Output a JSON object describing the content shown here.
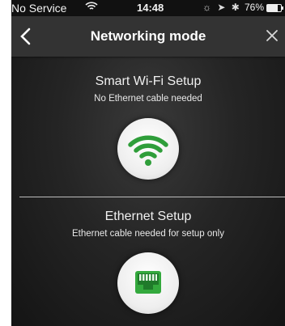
{
  "status_bar": {
    "carrier": "No Service",
    "time": "14:48",
    "battery": "76%",
    "icons": "☼ ➤ ✱"
  },
  "nav": {
    "title": "Networking mode",
    "back_icon": "chevron-left-icon",
    "close_icon": "close-icon"
  },
  "options": [
    {
      "title": "Smart Wi-Fi Setup",
      "subtitle": "No Ethernet cable needed",
      "icon": "wifi-icon",
      "icon_color": "#2f9e3a"
    },
    {
      "title": "Ethernet Setup",
      "subtitle": "Ethernet cable needed for setup only",
      "icon": "ethernet-port-icon",
      "icon_color": "#34a93d"
    }
  ]
}
